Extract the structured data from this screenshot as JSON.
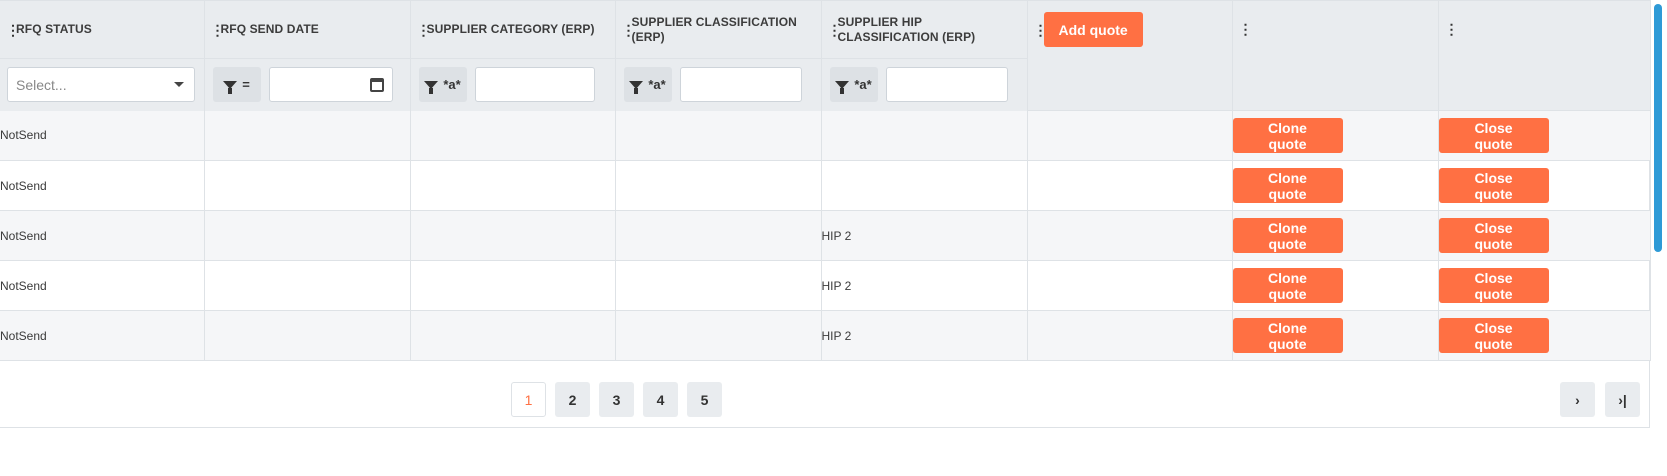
{
  "columns": [
    {
      "label": "RFQ STATUS"
    },
    {
      "label": "RFQ SEND DATE"
    },
    {
      "label": "SUPPLIER CATEGORY (ERP)"
    },
    {
      "label": "SUPPLIER CLASSIFICATION (ERP)"
    },
    {
      "label": "SUPPLIER HIP CLASSIFICATION (ERP)"
    },
    {
      "label": ""
    },
    {
      "label": ""
    },
    {
      "label": ""
    }
  ],
  "header_actions": {
    "add_quote": "Add quote"
  },
  "filters": {
    "status_placeholder": "Select...",
    "date_operator": "=",
    "text_operator": "*a*",
    "category_value": "",
    "classification_value": "",
    "hip_value": "",
    "date_value": ""
  },
  "rows": [
    {
      "status": "NotSend",
      "send_date": "",
      "category": "",
      "classification": "",
      "hip": "",
      "clone": "Clone quote",
      "close": "Close quote"
    },
    {
      "status": "NotSend",
      "send_date": "",
      "category": "",
      "classification": "",
      "hip": "",
      "clone": "Clone quote",
      "close": "Close quote"
    },
    {
      "status": "NotSend",
      "send_date": "",
      "category": "",
      "classification": "",
      "hip": "HIP 2",
      "clone": "Clone quote",
      "close": "Close quote"
    },
    {
      "status": "NotSend",
      "send_date": "",
      "category": "",
      "classification": "",
      "hip": "HIP 2",
      "clone": "Clone quote",
      "close": "Close quote"
    },
    {
      "status": "NotSend",
      "send_date": "",
      "category": "",
      "classification": "",
      "hip": "HIP 2",
      "clone": "Clone quote",
      "close": "Close quote"
    }
  ],
  "pagination": {
    "pages": [
      "1",
      "2",
      "3",
      "4",
      "5"
    ],
    "current": "1",
    "next_icon": "chevron-right-icon",
    "last_icon": "last-page-icon"
  },
  "colors": {
    "accent": "#ff7043",
    "header_bg": "#e9ecef",
    "scrollbar": "#2e9ad6"
  }
}
